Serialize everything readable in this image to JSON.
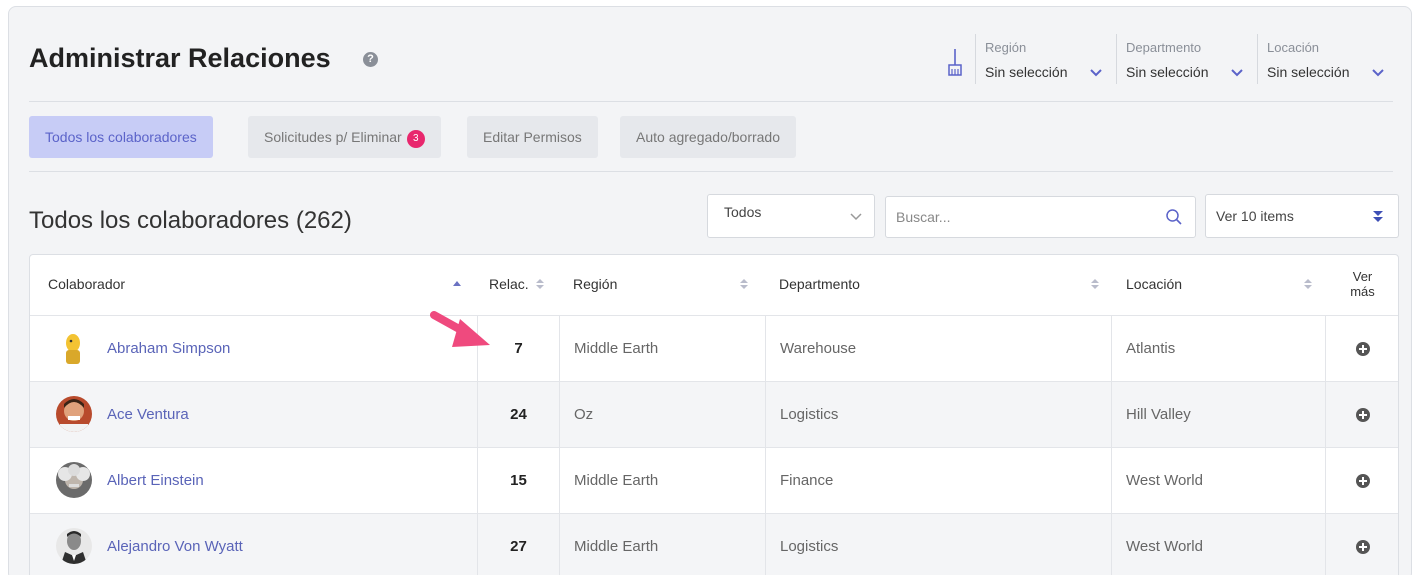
{
  "header": {
    "title": "Administrar Relaciones",
    "help_glyph": "?",
    "filters": [
      {
        "label": "Región",
        "value": "Sin selección"
      },
      {
        "label": "Departmento",
        "value": "Sin selección"
      },
      {
        "label": "Locación",
        "value": "Sin selección"
      }
    ]
  },
  "tabs": [
    {
      "label": "Todos los colaboradores",
      "active": true
    },
    {
      "label": "Solicitudes p/ Eliminar",
      "badge": "3"
    },
    {
      "label": "Editar Permisos"
    },
    {
      "label": "Auto agregado/borrado"
    }
  ],
  "section": {
    "title": "Todos los colaboradores (262)",
    "filter_select": "Todos",
    "search_placeholder": "Buscar...",
    "per_page": "Ver 10 items"
  },
  "table": {
    "headers": {
      "colaborador": "Colaborador",
      "relac": "Relac.",
      "region": "Región",
      "departmento": "Departmento",
      "locacion": "Locación",
      "ver_mas_1": "Ver",
      "ver_mas_2": "más"
    },
    "rows": [
      {
        "name": "Abraham Simpson",
        "relac": "7",
        "region": "Middle Earth",
        "departmento": "Warehouse",
        "locacion": "Atlantis"
      },
      {
        "name": "Ace Ventura",
        "relac": "24",
        "region": "Oz",
        "departmento": "Logistics",
        "locacion": "Hill Valley"
      },
      {
        "name": "Albert Einstein",
        "relac": "15",
        "region": "Middle Earth",
        "departmento": "Finance",
        "locacion": "West World"
      },
      {
        "name": "Alejandro Von Wyatt",
        "relac": "27",
        "region": "Middle Earth",
        "departmento": "Logistics",
        "locacion": "West World"
      }
    ]
  },
  "icons": {
    "help": "help-circle-icon",
    "clear_filters": "broom-icon",
    "dropdown": "chevron-down-icon",
    "search": "search-icon",
    "per_page": "double-chevron-down-icon",
    "sort": "sort-icon",
    "row_action": "plus-circle-icon",
    "annotation": "pointer-arrow-icon"
  },
  "colors": {
    "accent": "#5b63c9",
    "active_tab_bg": "#c7ccf6",
    "badge": "#e8276d",
    "link": "#5a64b8",
    "annotation_arrow": "#ef4a7e"
  }
}
